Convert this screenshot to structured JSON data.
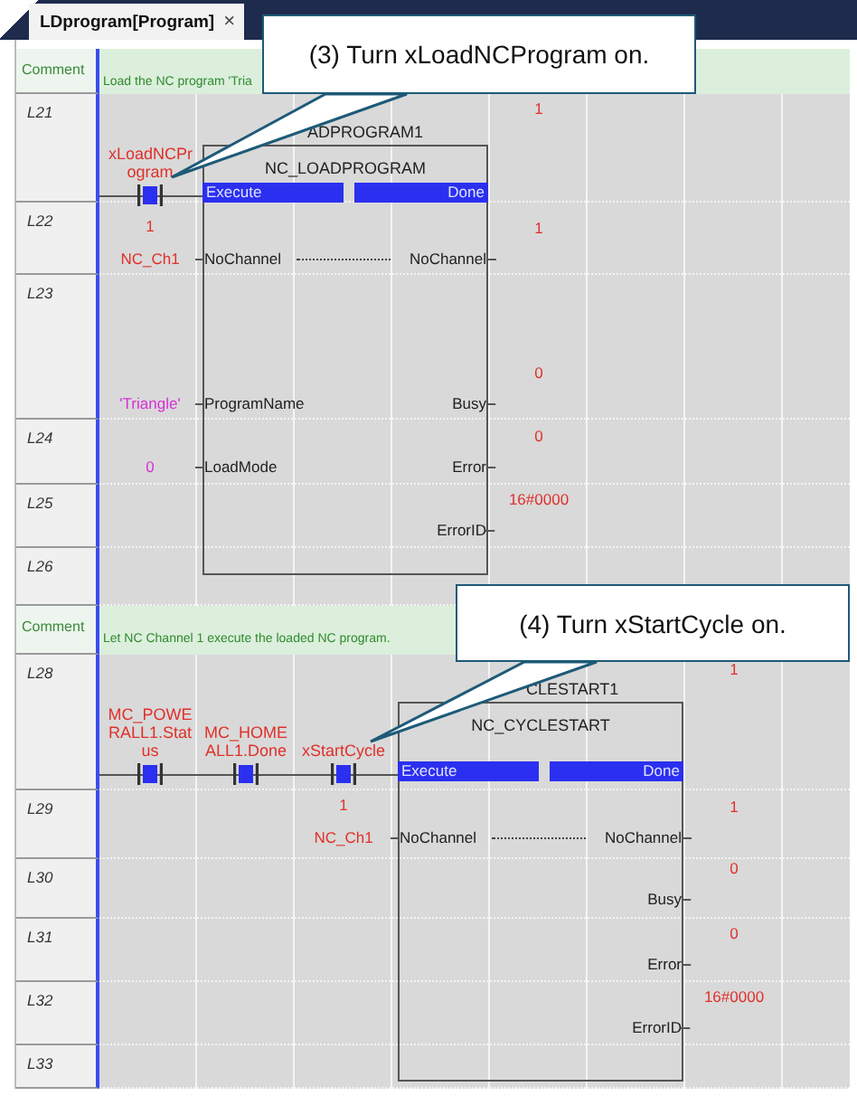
{
  "tab": {
    "title": "LDprogram[Program]",
    "close": "×",
    "selected": true
  },
  "rungs": [
    {
      "comment_label": "Comment",
      "comment": "Load the NC program 'Tria",
      "lines": [
        "L21",
        "L22",
        "L23",
        "L24",
        "L25",
        "L26"
      ],
      "contacts": [
        {
          "label": "xLoadNCPr ogram",
          "on": true
        }
      ],
      "block": {
        "instance": "ADPROGRAM1",
        "type": "NC_LOADPROGRAM",
        "execute": {
          "pin": "Execute",
          "on": true
        },
        "done": {
          "pin": "Done",
          "on": true,
          "monitor": "1"
        },
        "inputs": [
          {
            "pin": "NoChannel",
            "value": "NC_Ch1",
            "kind": "variable",
            "monitor": "1"
          },
          {
            "pin": "ProgramName",
            "value": "'Triangle'",
            "kind": "constant"
          },
          {
            "pin": "LoadMode",
            "value": "0",
            "kind": "constant"
          }
        ],
        "outputs": [
          {
            "pin": "NoChannel",
            "monitor": "1",
            "linked": true
          },
          {
            "pin": "Busy",
            "monitor": "0"
          },
          {
            "pin": "Error",
            "monitor": "0"
          },
          {
            "pin": "ErrorID",
            "monitor": "16#0000"
          }
        ]
      }
    },
    {
      "comment_label": "Comment",
      "comment": "Let NC Channel 1 execute the loaded NC program.",
      "lines": [
        "L28",
        "L29",
        "L30",
        "L31",
        "L32",
        "L33"
      ],
      "contacts": [
        {
          "label": "MC_POWE RALL1.Stat us",
          "on": true
        },
        {
          "label": "MC_HOME ALL1.Done",
          "on": true
        },
        {
          "label": "xStartCycle",
          "on": true
        }
      ],
      "block": {
        "instance": "CLESTART1",
        "type": "NC_CYCLESTART",
        "execute": {
          "pin": "Execute",
          "on": true
        },
        "done": {
          "pin": "Done",
          "on": true,
          "monitor": "1"
        },
        "inputs": [
          {
            "pin": "NoChannel",
            "value": "NC_Ch1",
            "kind": "variable",
            "monitor": "1"
          }
        ],
        "outputs": [
          {
            "pin": "NoChannel",
            "monitor": "1",
            "linked": true
          },
          {
            "pin": "Busy",
            "monitor": "0"
          },
          {
            "pin": "Error",
            "monitor": "0"
          },
          {
            "pin": "ErrorID",
            "monitor": "16#0000"
          }
        ]
      }
    }
  ],
  "callouts": [
    {
      "text": "(3) Turn xLoadNCProgram on."
    },
    {
      "text": "(4) Turn xStartCycle on."
    }
  ]
}
